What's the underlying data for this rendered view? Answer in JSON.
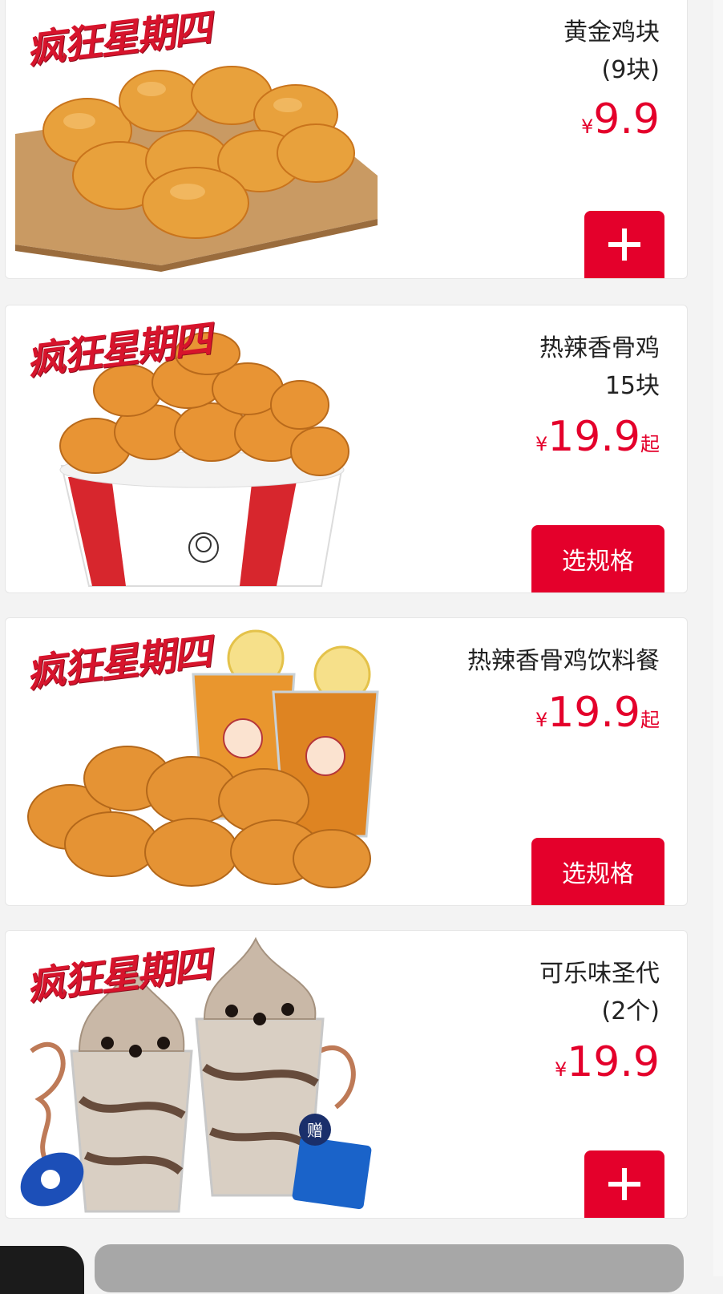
{
  "promo_label": "疯狂星期四",
  "currency": "¥",
  "products": [
    {
      "name_line1": "黄金鸡块",
      "name_line2": "(9块)",
      "price": "9.9",
      "price_suffix": "",
      "action_label": "+"
    },
    {
      "name_line1": "热辣香骨鸡",
      "name_line2": "15块",
      "price": "19.9",
      "price_suffix": "起",
      "action_label": "选规格"
    },
    {
      "name_line1": "热辣香骨鸡饮料餐",
      "name_line2": "",
      "price": "19.9",
      "price_suffix": "起",
      "action_label": "选规格"
    },
    {
      "name_line1": "可乐味圣代",
      "name_line2": "(2个)",
      "price": "19.9",
      "price_suffix": "",
      "action_label": "+"
    }
  ],
  "gift_badge": "赠",
  "colors": {
    "accent": "#e4002b",
    "background": "#f3f3f3",
    "card": "#ffffff",
    "nugget": "#e8a13c"
  },
  "icons": {
    "add": "plus-icon"
  }
}
